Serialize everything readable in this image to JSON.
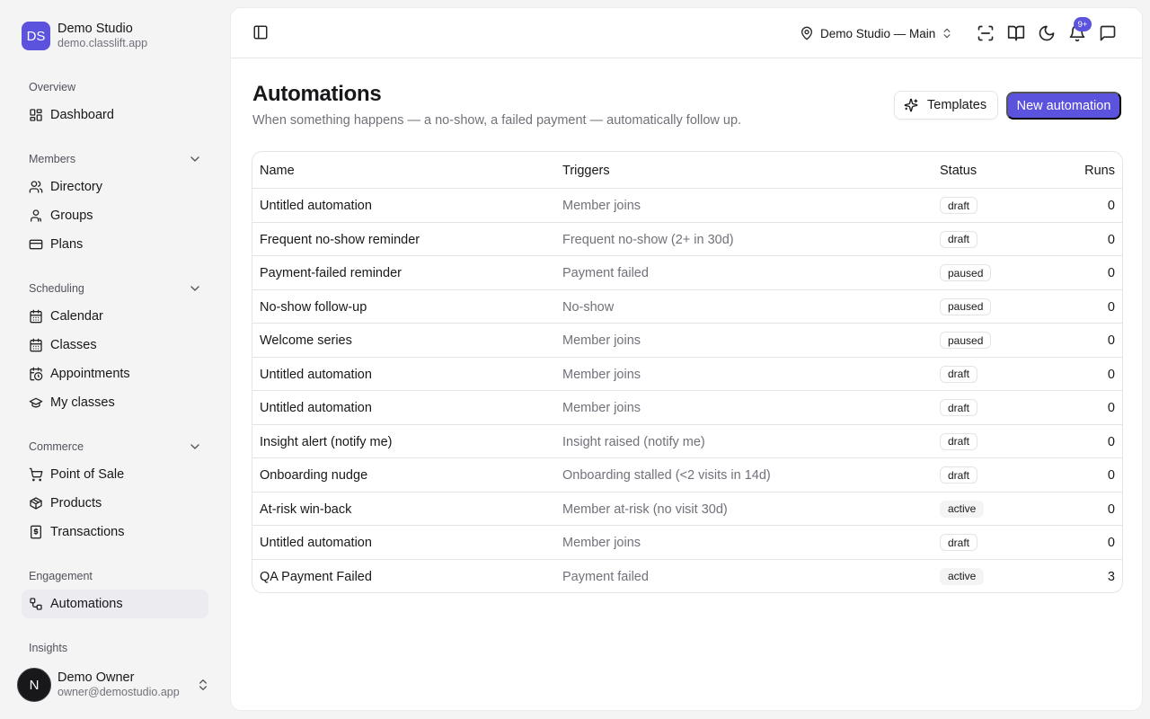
{
  "brand": {
    "logo": "DS",
    "name": "Demo Studio",
    "domain": "demo.classlift.app"
  },
  "sidebar": {
    "groups": [
      {
        "label": "Overview",
        "items": [
          {
            "label": "Dashboard",
            "icon": "dashboard-icon"
          }
        ]
      },
      {
        "label": "Members",
        "collapsible": true,
        "items": [
          {
            "label": "Directory",
            "icon": "users-icon"
          },
          {
            "label": "Groups",
            "icon": "user-icon"
          },
          {
            "label": "Plans",
            "icon": "credit-card-icon"
          }
        ]
      },
      {
        "label": "Scheduling",
        "collapsible": true,
        "items": [
          {
            "label": "Calendar",
            "icon": "calendar-icon"
          },
          {
            "label": "Classes",
            "icon": "calendar-icon"
          },
          {
            "label": "Appointments",
            "icon": "calendar-clock-icon"
          },
          {
            "label": "My classes",
            "icon": "graduation-cap-icon"
          }
        ]
      },
      {
        "label": "Commerce",
        "collapsible": true,
        "items": [
          {
            "label": "Point of Sale",
            "icon": "cart-icon"
          },
          {
            "label": "Products",
            "icon": "package-icon"
          },
          {
            "label": "Transactions",
            "icon": "receipt-icon"
          }
        ]
      },
      {
        "label": "Engagement",
        "items": [
          {
            "label": "Automations",
            "icon": "workflow-icon",
            "active": true
          }
        ]
      },
      {
        "label": "Insights",
        "items": []
      }
    ]
  },
  "user": {
    "initial": "N",
    "name": "Demo Owner",
    "email": "owner@demostudio.app"
  },
  "topbar": {
    "location": "Demo Studio — Main",
    "notification_count": "9+"
  },
  "page": {
    "title": "Automations",
    "description": "When something happens — a no-show, a failed payment — automatically follow up.",
    "templates_label": "Templates",
    "new_label": "New automation"
  },
  "table": {
    "columns": {
      "name": "Name",
      "triggers": "Triggers",
      "status": "Status",
      "runs": "Runs"
    },
    "rows": [
      {
        "name": "Untitled automation",
        "trigger": "Member joins",
        "status": "draft",
        "runs": "0"
      },
      {
        "name": "Frequent no-show reminder",
        "trigger": "Frequent no-show (2+ in 30d)",
        "status": "draft",
        "runs": "0"
      },
      {
        "name": "Payment-failed reminder",
        "trigger": "Payment failed",
        "status": "paused",
        "runs": "0"
      },
      {
        "name": "No-show follow-up",
        "trigger": "No-show",
        "status": "paused",
        "runs": "0"
      },
      {
        "name": "Welcome series",
        "trigger": "Member joins",
        "status": "paused",
        "runs": "0"
      },
      {
        "name": "Untitled automation",
        "trigger": "Member joins",
        "status": "draft",
        "runs": "0"
      },
      {
        "name": "Untitled automation",
        "trigger": "Member joins",
        "status": "draft",
        "runs": "0"
      },
      {
        "name": "Insight alert (notify me)",
        "trigger": "Insight raised (notify me)",
        "status": "draft",
        "runs": "0"
      },
      {
        "name": "Onboarding nudge",
        "trigger": "Onboarding stalled (<2 visits in 14d)",
        "status": "draft",
        "runs": "0"
      },
      {
        "name": "At-risk win-back",
        "trigger": "Member at-risk (no visit 30d)",
        "status": "active",
        "runs": "0"
      },
      {
        "name": "Untitled automation",
        "trigger": "Member joins",
        "status": "draft",
        "runs": "0"
      },
      {
        "name": "QA Payment Failed",
        "trigger": "Payment failed",
        "status": "active",
        "runs": "3"
      }
    ]
  },
  "colors": {
    "accent": "#5b53dd",
    "muted_text": "#71717a",
    "border": "#e4e4e7"
  }
}
